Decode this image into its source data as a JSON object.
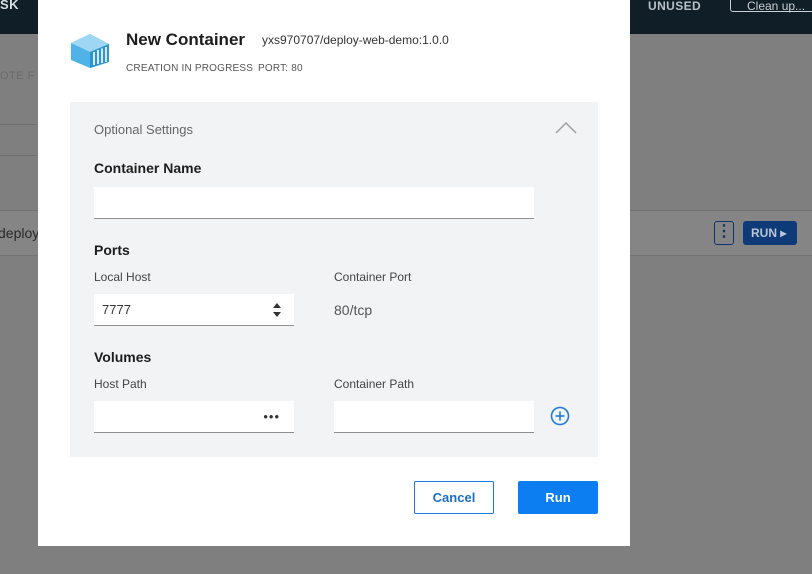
{
  "background": {
    "topbar_left": "SK",
    "unused_label": "UNUSED",
    "cleanup_label": "Clean up...",
    "note_label": "OTE F",
    "row_name": "deploy",
    "row_menu_glyph": "⋮",
    "row_run_label": "RUN ▸"
  },
  "modal": {
    "title": "New Container",
    "image": "yxs970707/deploy-web-demo:1.0.0",
    "status": "CREATION IN PROGRESS",
    "port": "PORT: 80",
    "logo_icon": "docker-container-icon",
    "optional_title": "Optional Settings",
    "container_name": {
      "label": "Container Name",
      "value": ""
    },
    "ports": {
      "heading": "Ports",
      "local_host_label": "Local Host",
      "local_host_value": "7777",
      "container_port_label": "Container Port",
      "container_port_value": "80/tcp"
    },
    "volumes": {
      "heading": "Volumes",
      "host_path_label": "Host Path",
      "host_path_value": "",
      "browse_glyph": "•••",
      "container_path_label": "Container Path",
      "container_path_value": ""
    },
    "cancel_label": "Cancel",
    "run_label": "Run"
  },
  "colors": {
    "accent": "#0d7ef2",
    "panel_bg": "#f2f3f4",
    "overlay": "#7f7f7f"
  }
}
